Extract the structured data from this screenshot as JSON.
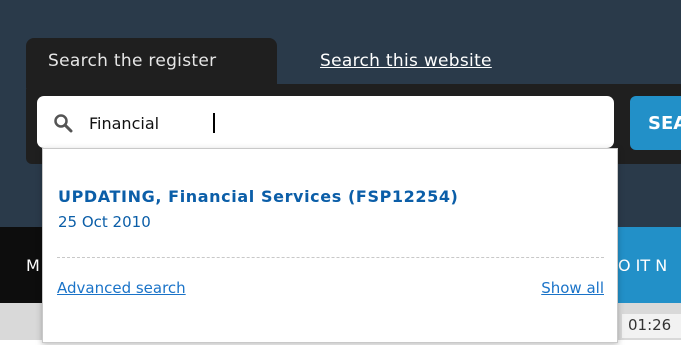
{
  "tabs": {
    "active_label": "Search the register",
    "link_label": "Search this website"
  },
  "search": {
    "value": "Financial",
    "button_label": "SEARCH"
  },
  "nav": {
    "left_text": "M",
    "right_text": "O IT N"
  },
  "time_chip": "01:26",
  "dropdown": {
    "results": [
      {
        "title": "UPDATING, Financial Services (FSP12254)",
        "date": "25 Oct 2010"
      }
    ],
    "advanced_label": "Advanced search",
    "show_all_label": "Show all"
  },
  "colors": {
    "header_bg": "#2a3a4a",
    "panel_bg": "#1f1f1f",
    "accent_blue": "#2290c8",
    "link_blue": "#1a73c8",
    "result_blue": "#0b5ea8"
  },
  "icons": {
    "search": "magnifier-icon"
  }
}
